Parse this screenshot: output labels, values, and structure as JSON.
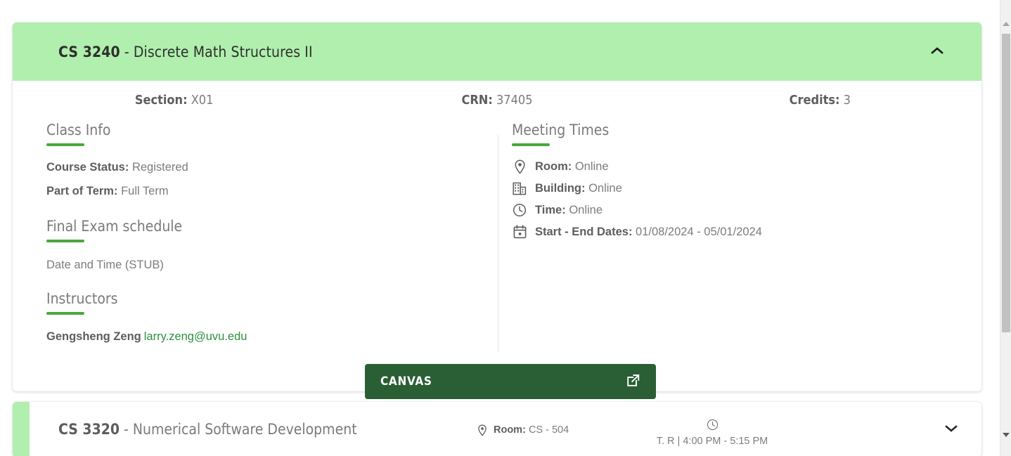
{
  "courses": [
    {
      "code": "CS 3240",
      "separator": "-",
      "name": "Discrete Math Structures II",
      "expanded": true,
      "header_color": "#b0efad",
      "collapse_icon": "chevron-up-icon",
      "meta": [
        {
          "label": "Section:",
          "value": "X01"
        },
        {
          "label": "CRN:",
          "value": "37405"
        },
        {
          "label": "Credits:",
          "value": "3"
        }
      ],
      "class_info": {
        "heading": "Class Info",
        "rows": [
          {
            "label": "Course Status:",
            "value": "Registered"
          },
          {
            "label": "Part of Term:",
            "value": "Full Term"
          }
        ]
      },
      "final_exam": {
        "heading": "Final Exam schedule",
        "text": "Date and Time (STUB)"
      },
      "instructors": {
        "heading": "Instructors",
        "name": "Gengsheng Zeng",
        "email": "larry.zeng@uvu.edu"
      },
      "meeting_times": {
        "heading": "Meeting Times",
        "rows": [
          {
            "icon": "location-pin-icon",
            "label": "Room:",
            "value": "Online"
          },
          {
            "icon": "building-icon",
            "label": "Building:",
            "value": "Online"
          },
          {
            "icon": "clock-icon",
            "label": "Time:",
            "value": "Online"
          },
          {
            "icon": "calendar-icon",
            "label": "Start - End Dates:",
            "value": "01/08/2024 - 05/01/2024"
          }
        ]
      },
      "canvas_button": {
        "label": "CANVAS",
        "icon": "external-link-icon",
        "color": "#2a5e34"
      }
    },
    {
      "code": "CS 3320",
      "separator": "-",
      "name": "Numerical Software Development",
      "expanded": false,
      "strip_color": "#b0efad",
      "expand_icon": "chevron-down-icon",
      "room": {
        "icon": "location-pin-icon",
        "label": "Room:",
        "value": "CS - 504"
      },
      "time": {
        "icon": "clock-icon",
        "value": "T. R | 4:00 PM - 5:15 PM"
      }
    }
  ],
  "scrollbar": {
    "up_icon": "scroll-up-arrow-icon",
    "down_icon": "scroll-down-arrow-icon",
    "thumb": "scrollbar-thumb"
  },
  "accent_color": "#4ba63e",
  "link_color": "#2f8f3e"
}
